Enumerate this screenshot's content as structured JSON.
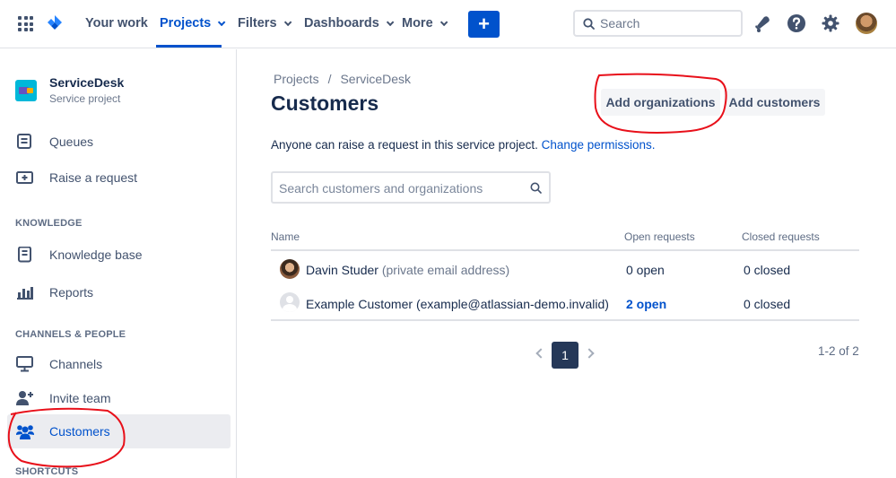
{
  "topnav": {
    "items": [
      {
        "label": "Your work",
        "has_menu": false
      },
      {
        "label": "Projects",
        "has_menu": true,
        "active": true
      },
      {
        "label": "Filters",
        "has_menu": true
      },
      {
        "label": "Dashboards",
        "has_menu": true
      },
      {
        "label": "More",
        "has_menu": true
      }
    ],
    "create_label": "+",
    "search_placeholder": "Search",
    "icons": [
      "app-switcher-icon",
      "jira-logo",
      "notifications-icon",
      "help-icon",
      "settings-icon",
      "profile-avatar"
    ],
    "accent_color": "#0052cc"
  },
  "sidebar": {
    "project_name": "ServiceDesk",
    "project_type": "Service project",
    "items": [
      {
        "label": "Queues",
        "icon": "queues-icon"
      },
      {
        "label": "Raise a request",
        "icon": "raise-request-icon"
      }
    ],
    "knowledge_header": "KNOWLEDGE",
    "knowledge_items": [
      {
        "label": "Knowledge base",
        "icon": "knowledge-base-icon"
      },
      {
        "label": "Reports",
        "icon": "reports-icon"
      }
    ],
    "channels_header": "CHANNELS & PEOPLE",
    "channels_items": [
      {
        "label": "Channels",
        "icon": "channels-icon"
      },
      {
        "label": "Invite team",
        "icon": "invite-team-icon"
      },
      {
        "label": "Customers",
        "icon": "customers-icon",
        "selected": true
      }
    ],
    "shortcuts_header": "SHORTCUTS"
  },
  "main": {
    "breadcrumb": [
      "Projects",
      "ServiceDesk"
    ],
    "breadcrumb_sep": "/",
    "title": "Customers",
    "add_organizations_label": "Add organizations",
    "add_customers_label": "Add customers",
    "info_text": "Anyone can raise a request in this service project.",
    "info_link": "Change permissions.",
    "search_placeholder": "Search customers and organizations",
    "table": {
      "headers": [
        "Name",
        "Open requests",
        "Closed requests"
      ],
      "rows": [
        {
          "name": "Davin Studer",
          "detail": "(private email address)",
          "open": "0 open",
          "closed": "0 closed",
          "open_is_link": false
        },
        {
          "name": "Example Customer",
          "detail": "(example@atlassian-demo.invalid)",
          "open": "2 open",
          "closed": "0 closed",
          "open_is_link": true
        }
      ]
    },
    "pagination": {
      "current": "1",
      "count": "1-2 of 2"
    }
  },
  "annotation_color": "#e8101a"
}
